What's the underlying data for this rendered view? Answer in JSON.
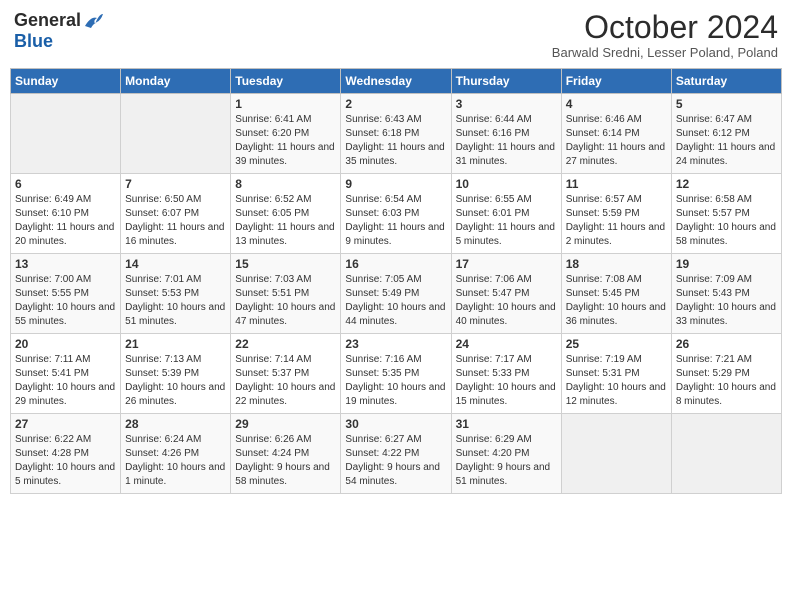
{
  "logo": {
    "general": "General",
    "blue": "Blue"
  },
  "title": "October 2024",
  "subtitle": "Barwald Sredni, Lesser Poland, Poland",
  "days_header": [
    "Sunday",
    "Monday",
    "Tuesday",
    "Wednesday",
    "Thursday",
    "Friday",
    "Saturday"
  ],
  "weeks": [
    [
      {
        "day": "",
        "text": ""
      },
      {
        "day": "",
        "text": ""
      },
      {
        "day": "1",
        "text": "Sunrise: 6:41 AM\nSunset: 6:20 PM\nDaylight: 11 hours and 39 minutes."
      },
      {
        "day": "2",
        "text": "Sunrise: 6:43 AM\nSunset: 6:18 PM\nDaylight: 11 hours and 35 minutes."
      },
      {
        "day": "3",
        "text": "Sunrise: 6:44 AM\nSunset: 6:16 PM\nDaylight: 11 hours and 31 minutes."
      },
      {
        "day": "4",
        "text": "Sunrise: 6:46 AM\nSunset: 6:14 PM\nDaylight: 11 hours and 27 minutes."
      },
      {
        "day": "5",
        "text": "Sunrise: 6:47 AM\nSunset: 6:12 PM\nDaylight: 11 hours and 24 minutes."
      }
    ],
    [
      {
        "day": "6",
        "text": "Sunrise: 6:49 AM\nSunset: 6:10 PM\nDaylight: 11 hours and 20 minutes."
      },
      {
        "day": "7",
        "text": "Sunrise: 6:50 AM\nSunset: 6:07 PM\nDaylight: 11 hours and 16 minutes."
      },
      {
        "day": "8",
        "text": "Sunrise: 6:52 AM\nSunset: 6:05 PM\nDaylight: 11 hours and 13 minutes."
      },
      {
        "day": "9",
        "text": "Sunrise: 6:54 AM\nSunset: 6:03 PM\nDaylight: 11 hours and 9 minutes."
      },
      {
        "day": "10",
        "text": "Sunrise: 6:55 AM\nSunset: 6:01 PM\nDaylight: 11 hours and 5 minutes."
      },
      {
        "day": "11",
        "text": "Sunrise: 6:57 AM\nSunset: 5:59 PM\nDaylight: 11 hours and 2 minutes."
      },
      {
        "day": "12",
        "text": "Sunrise: 6:58 AM\nSunset: 5:57 PM\nDaylight: 10 hours and 58 minutes."
      }
    ],
    [
      {
        "day": "13",
        "text": "Sunrise: 7:00 AM\nSunset: 5:55 PM\nDaylight: 10 hours and 55 minutes."
      },
      {
        "day": "14",
        "text": "Sunrise: 7:01 AM\nSunset: 5:53 PM\nDaylight: 10 hours and 51 minutes."
      },
      {
        "day": "15",
        "text": "Sunrise: 7:03 AM\nSunset: 5:51 PM\nDaylight: 10 hours and 47 minutes."
      },
      {
        "day": "16",
        "text": "Sunrise: 7:05 AM\nSunset: 5:49 PM\nDaylight: 10 hours and 44 minutes."
      },
      {
        "day": "17",
        "text": "Sunrise: 7:06 AM\nSunset: 5:47 PM\nDaylight: 10 hours and 40 minutes."
      },
      {
        "day": "18",
        "text": "Sunrise: 7:08 AM\nSunset: 5:45 PM\nDaylight: 10 hours and 36 minutes."
      },
      {
        "day": "19",
        "text": "Sunrise: 7:09 AM\nSunset: 5:43 PM\nDaylight: 10 hours and 33 minutes."
      }
    ],
    [
      {
        "day": "20",
        "text": "Sunrise: 7:11 AM\nSunset: 5:41 PM\nDaylight: 10 hours and 29 minutes."
      },
      {
        "day": "21",
        "text": "Sunrise: 7:13 AM\nSunset: 5:39 PM\nDaylight: 10 hours and 26 minutes."
      },
      {
        "day": "22",
        "text": "Sunrise: 7:14 AM\nSunset: 5:37 PM\nDaylight: 10 hours and 22 minutes."
      },
      {
        "day": "23",
        "text": "Sunrise: 7:16 AM\nSunset: 5:35 PM\nDaylight: 10 hours and 19 minutes."
      },
      {
        "day": "24",
        "text": "Sunrise: 7:17 AM\nSunset: 5:33 PM\nDaylight: 10 hours and 15 minutes."
      },
      {
        "day": "25",
        "text": "Sunrise: 7:19 AM\nSunset: 5:31 PM\nDaylight: 10 hours and 12 minutes."
      },
      {
        "day": "26",
        "text": "Sunrise: 7:21 AM\nSunset: 5:29 PM\nDaylight: 10 hours and 8 minutes."
      }
    ],
    [
      {
        "day": "27",
        "text": "Sunrise: 6:22 AM\nSunset: 4:28 PM\nDaylight: 10 hours and 5 minutes."
      },
      {
        "day": "28",
        "text": "Sunrise: 6:24 AM\nSunset: 4:26 PM\nDaylight: 10 hours and 1 minute."
      },
      {
        "day": "29",
        "text": "Sunrise: 6:26 AM\nSunset: 4:24 PM\nDaylight: 9 hours and 58 minutes."
      },
      {
        "day": "30",
        "text": "Sunrise: 6:27 AM\nSunset: 4:22 PM\nDaylight: 9 hours and 54 minutes."
      },
      {
        "day": "31",
        "text": "Sunrise: 6:29 AM\nSunset: 4:20 PM\nDaylight: 9 hours and 51 minutes."
      },
      {
        "day": "",
        "text": ""
      },
      {
        "day": "",
        "text": ""
      }
    ]
  ]
}
